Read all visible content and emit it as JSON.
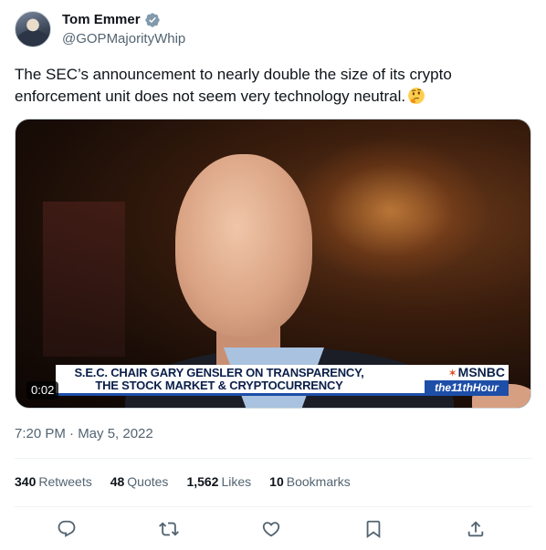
{
  "author": {
    "name": "Tom Emmer",
    "handle": "@GOPMajorityWhip",
    "verified_icon": "verified-badge-icon"
  },
  "tweet": {
    "text": "The SEC’s announcement to nearly double the size of its crypto enforcement unit does not seem very technology neutral.",
    "emoji": "thinking-face-emoji"
  },
  "media": {
    "duration": "0:02",
    "lower_third": {
      "line1": "S.E.C. CHAIR GARY GENSLER ON TRANSPARENCY,",
      "line2": "THE STOCK MARKET & CRYPTOCURRENCY",
      "network": "MSNBC",
      "show": "the11thHour"
    }
  },
  "timestamp": "7:20 PM · May 5, 2022",
  "stats": {
    "retweets": {
      "count": "340",
      "label": "Retweets"
    },
    "quotes": {
      "count": "48",
      "label": "Quotes"
    },
    "likes": {
      "count": "1,562",
      "label": "Likes"
    },
    "bookmarks": {
      "count": "10",
      "label": "Bookmarks"
    }
  },
  "actions": [
    "reply-icon",
    "retweet-icon",
    "like-icon",
    "bookmark-icon",
    "share-icon"
  ],
  "colors": {
    "text": "#0f1419",
    "secondary": "#536471",
    "verified": "#829aab",
    "msnbc_blue": "#1d4ea8"
  }
}
